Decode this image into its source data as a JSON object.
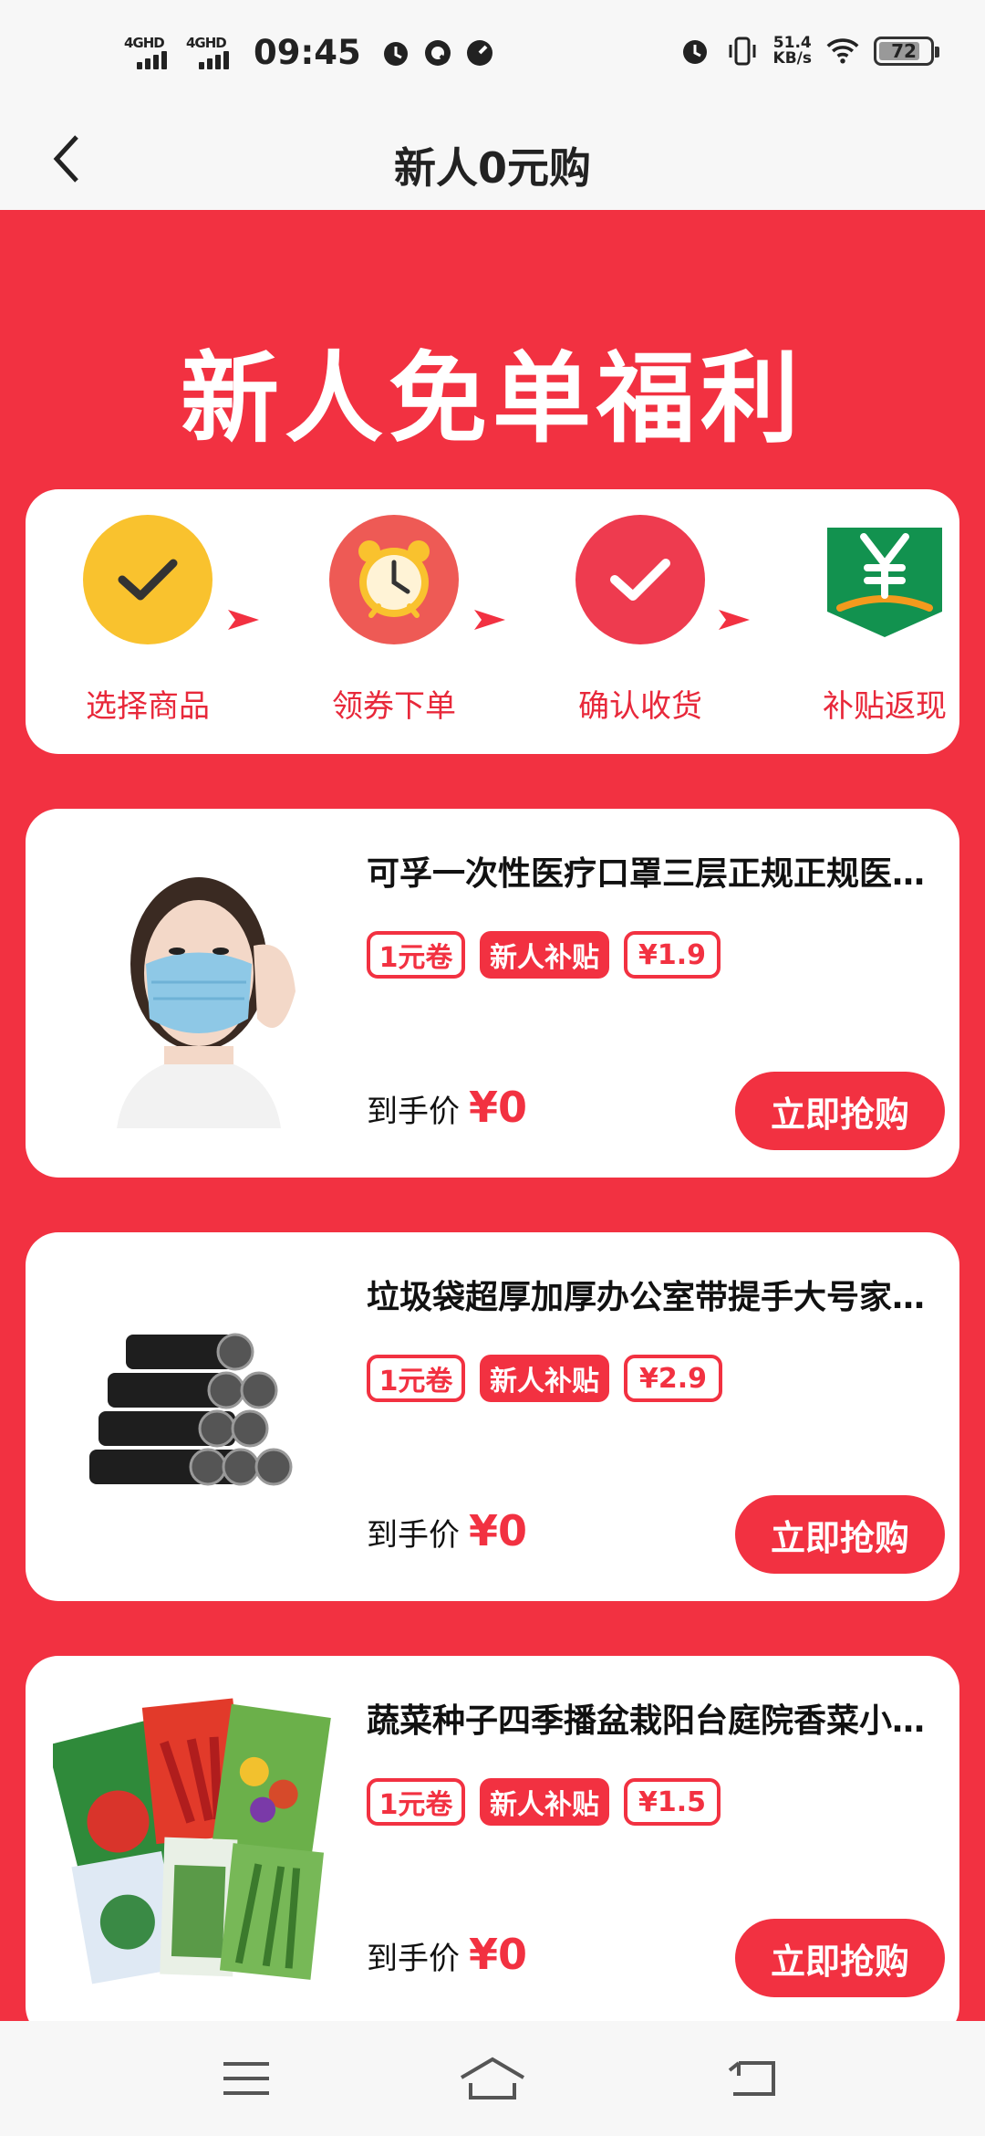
{
  "status_bar": {
    "network1": "4GHD",
    "network2": "4GHD",
    "time": "09:45",
    "speed_value": "51.4",
    "speed_unit": "KB/s",
    "battery": "72"
  },
  "header": {
    "title": "新人0元购"
  },
  "hero": {
    "title": "新人免单福利"
  },
  "steps": [
    {
      "label": "选择商品",
      "icon": "check-circle-icon"
    },
    {
      "label": "领券下单",
      "icon": "alarm-clock-icon"
    },
    {
      "label": "确认收货",
      "icon": "check-badge-icon"
    },
    {
      "label": "补贴返现",
      "icon": "yen-banner-icon"
    }
  ],
  "products": [
    {
      "title": "可孚一次性医疗口罩三层正规正规医用外科口罩",
      "coupon": "1元卷",
      "subsidy": "新人补贴",
      "orig_price": "¥1.9",
      "price_label": "到手价",
      "final_price": "¥0",
      "button": "立即抢购"
    },
    {
      "title": "垃圾袋超厚加厚办公室带提手大号家用实惠装",
      "coupon": "1元卷",
      "subsidy": "新人补贴",
      "orig_price": "¥2.9",
      "price_label": "到手价",
      "final_price": "¥0",
      "button": "立即抢购"
    },
    {
      "title": "蔬菜种子四季播盆栽阳台庭院香菜小白菜种子",
      "coupon": "1元卷",
      "subsidy": "新人补贴",
      "orig_price": "¥1.5",
      "price_label": "到手价",
      "final_price": "¥0",
      "button": "立即抢购"
    }
  ],
  "colors": {
    "accent": "#f23141",
    "yellow": "#f9c22e",
    "green": "#12924f"
  }
}
